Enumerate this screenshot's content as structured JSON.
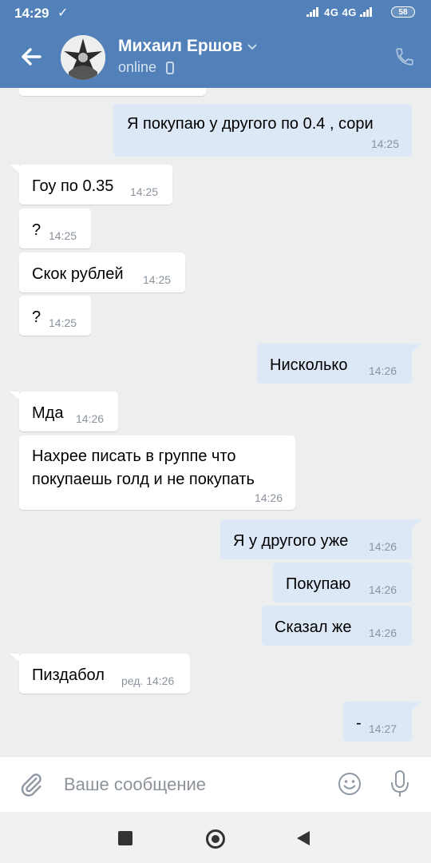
{
  "status_bar": {
    "time": "14:29",
    "network": "4G  4G",
    "battery": "58"
  },
  "header": {
    "name": "Михаил Ершов",
    "status": "online"
  },
  "messages": [
    {
      "dir": "out",
      "text": "Я покупаю у другого по 0.4 , сори",
      "time": "14:25"
    },
    {
      "dir": "in",
      "text": "Гоу по 0.35",
      "time": "14:25"
    },
    {
      "dir": "in",
      "text": "?",
      "time": "14:25"
    },
    {
      "dir": "in",
      "text": "Скок рублей",
      "time": "14:25"
    },
    {
      "dir": "in",
      "text": "?",
      "time": "14:25"
    },
    {
      "dir": "out",
      "text": "Нисколько",
      "time": "14:26"
    },
    {
      "dir": "in",
      "text": "Мда",
      "time": "14:26"
    },
    {
      "dir": "in",
      "line1": "Нахрее писать в группе что",
      "line2": "покупаешь голд и не покупать",
      "time": "14:26"
    },
    {
      "dir": "out",
      "text": "Я у другого уже",
      "time": "14:26"
    },
    {
      "dir": "out",
      "text": "Покупаю",
      "time": "14:26"
    },
    {
      "dir": "out",
      "text": "Сказал же",
      "time": "14:26"
    },
    {
      "dir": "in",
      "text": "Пиздабол",
      "time": "ред. 14:26"
    },
    {
      "dir": "out",
      "text": "-",
      "time": "14:27"
    }
  ],
  "composer": {
    "placeholder": "Ваше сообщение"
  },
  "colors": {
    "header": "#5181b8",
    "incoming": "#ffffff",
    "outgoing": "#dde8f6",
    "background": "#edeef0"
  }
}
